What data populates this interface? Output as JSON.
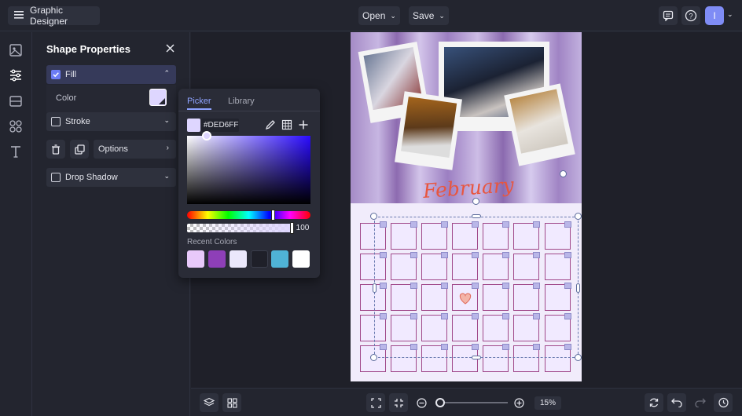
{
  "app": {
    "title": "Graphic Designer"
  },
  "toolbar": {
    "open_label": "Open",
    "save_label": "Save",
    "avatar_initial": "I"
  },
  "panel": {
    "title": "Shape Properties",
    "fill_label": "Fill",
    "color_label": "Color",
    "stroke_label": "Stroke",
    "options_label": "Options",
    "drop_shadow_label": "Drop Shadow",
    "fill_color": "#DED6FF"
  },
  "picker": {
    "tab_picker": "Picker",
    "tab_library": "Library",
    "hex_value": "#DED6FF",
    "opacity_value": "100",
    "recent_colors_label": "Recent Colors",
    "recent_colors": [
      "#e8c9fa",
      "#8e3fb8",
      "#ebe8fb",
      "#1f2029",
      "#4fb3d6",
      "#ffffff"
    ]
  },
  "canvas": {
    "month_title": "February"
  },
  "bottom": {
    "zoom_value": "15%"
  }
}
